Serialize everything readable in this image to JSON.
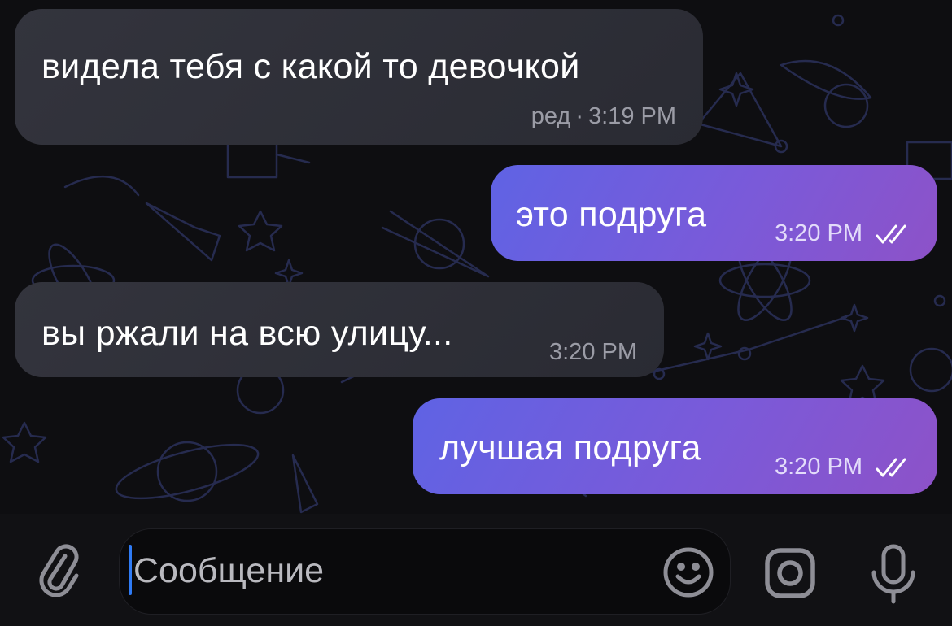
{
  "messages": [
    {
      "direction": "incoming",
      "text": "видела тебя с какой то девочкой",
      "edited_label": "ред",
      "separator": "·",
      "time": "3:19 PM"
    },
    {
      "direction": "outgoing",
      "text": "это подруга",
      "time": "3:20 PM",
      "status": "read"
    },
    {
      "direction": "incoming",
      "text": "вы ржали на всю улицу...",
      "time": "3:20 PM"
    },
    {
      "direction": "outgoing",
      "text": "лучшая подруга",
      "time": "3:20 PM",
      "status": "read"
    }
  ],
  "composer": {
    "placeholder": "Сообщение",
    "value": "",
    "icons": [
      "paperclip-icon",
      "emoji-icon",
      "camera-icon",
      "microphone-icon"
    ]
  },
  "colors": {
    "background": "#0e0e11",
    "incoming_bubble": "#2f3038",
    "outgoing_bubble_start": "#5f63e4",
    "outgoing_bubble_end": "#8d52c8",
    "caret": "#2f7bf5",
    "doodle": "#2a2f55"
  }
}
